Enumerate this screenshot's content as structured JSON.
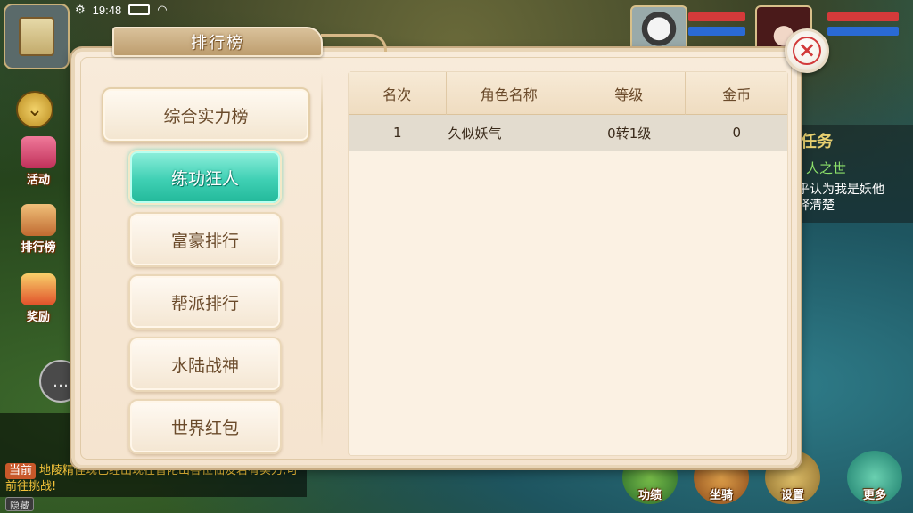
{
  "status_bar": {
    "time": "19:48"
  },
  "hud": {
    "side_buttons": [
      {
        "label": "活动"
      },
      {
        "label": "排行榜"
      },
      {
        "label": "奖励"
      }
    ],
    "bottom_buttons": [
      {
        "label": "功绩"
      },
      {
        "label": "坐骑"
      },
      {
        "label": "设置"
      },
      {
        "label": "更多"
      }
    ],
    "task": {
      "title": "任务",
      "subtitle": "人之世",
      "body": "以乎认为我是妖他解释清楚"
    },
    "chat": {
      "channel_tag": "当前",
      "message": "地陵精怪现已经出现在普陀山各位仙友若有实力,可前往挑战!",
      "bottom_tag": "隐藏"
    }
  },
  "dialog": {
    "title": "排行榜",
    "close_icon": "close-icon",
    "categories": [
      {
        "label": "综合实力榜"
      }
    ],
    "sub_tabs": [
      {
        "label": "练功狂人",
        "active": true
      },
      {
        "label": "富豪排行",
        "active": false
      },
      {
        "label": "帮派排行",
        "active": false
      },
      {
        "label": "水陆战神",
        "active": false
      },
      {
        "label": "世界红包",
        "active": false
      }
    ],
    "table": {
      "headers": [
        "名次",
        "角色名称",
        "等级",
        "金币"
      ],
      "rows": [
        {
          "rank": "1",
          "name": "久似妖气",
          "level": "0转1级",
          "gold": "0"
        }
      ]
    }
  },
  "colors": {
    "active_tab": "#3fd0b4",
    "panel_bg": "#f8ebda",
    "text_brown": "#6a4a2a",
    "close_red": "#d23a3a"
  }
}
